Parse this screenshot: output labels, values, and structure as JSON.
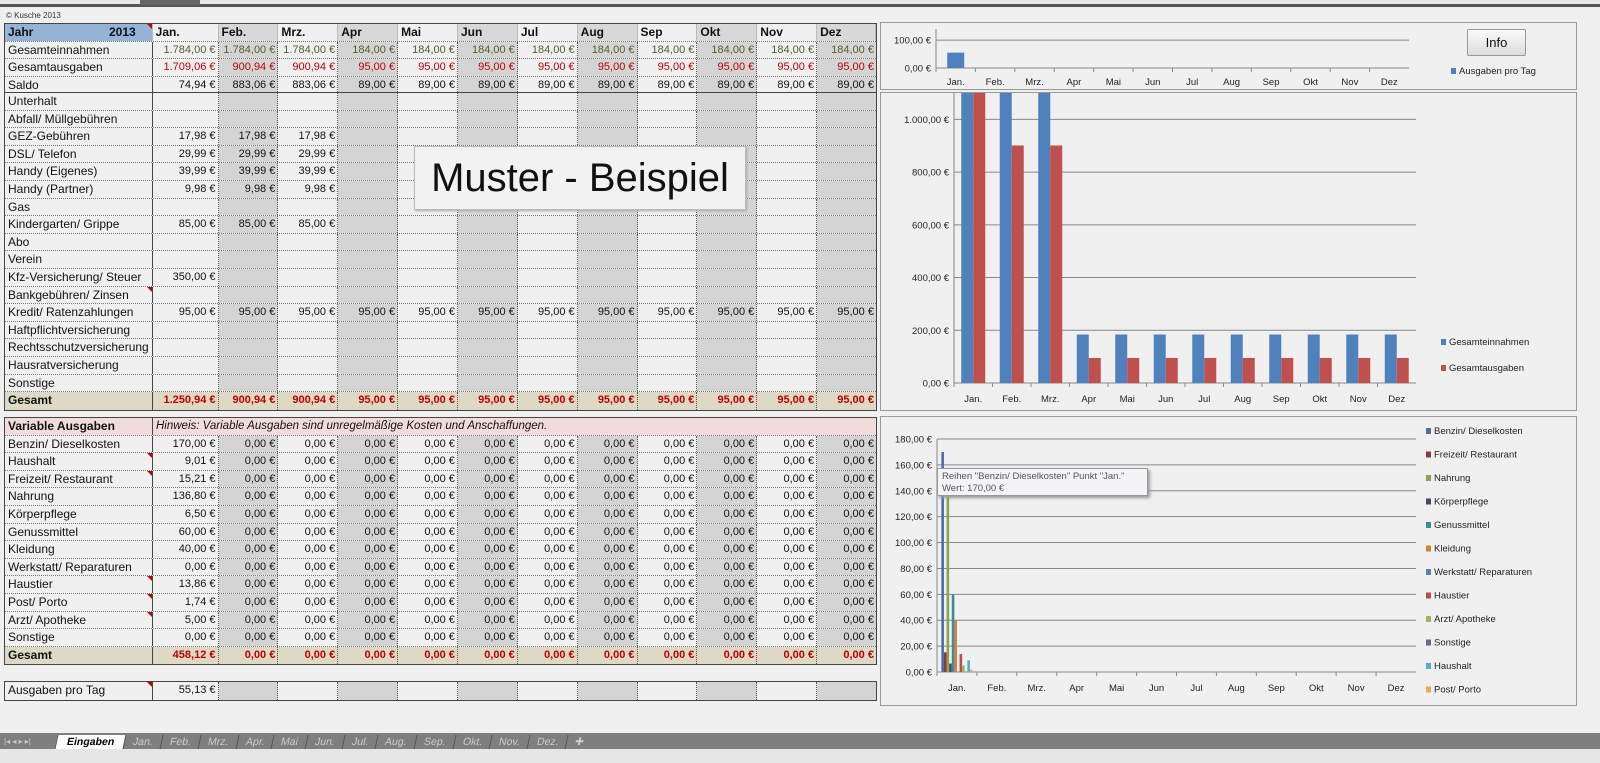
{
  "copyright": "© Kusche 2013",
  "header": {
    "jahr_label": "Jahr",
    "year": "2013"
  },
  "months": [
    "Jan.",
    "Feb.",
    "Mrz.",
    "Apr",
    "Mai",
    "Jun",
    "Jul",
    "Aug",
    "Sep",
    "Okt",
    "Nov",
    "Dez"
  ],
  "summary": [
    {
      "label": "Gesamteinnahmen",
      "color": "green",
      "values": [
        "1.784,00 €",
        "1.784,00 €",
        "1.784,00 €",
        "184,00 €",
        "184,00 €",
        "184,00 €",
        "184,00 €",
        "184,00 €",
        "184,00 €",
        "184,00 €",
        "184,00 €",
        "184,00 €"
      ]
    },
    {
      "label": "Gesamtausgaben",
      "color": "red",
      "values": [
        "1.709,06 €",
        "900,94 €",
        "900,94 €",
        "95,00 €",
        "95,00 €",
        "95,00 €",
        "95,00 €",
        "95,00 €",
        "95,00 €",
        "95,00 €",
        "95,00 €",
        "95,00 €"
      ]
    },
    {
      "label": "Saldo",
      "color": "",
      "values": [
        "74,94 €",
        "883,06 €",
        "883,06 €",
        "89,00 €",
        "89,00 €",
        "89,00 €",
        "89,00 €",
        "89,00 €",
        "89,00 €",
        "89,00 €",
        "89,00 €",
        "89,00 €"
      ]
    }
  ],
  "fixed": [
    {
      "label": "Unterhalt",
      "values": [
        "",
        "",
        "",
        "",
        "",
        "",
        "",
        "",
        "",
        "",
        "",
        ""
      ]
    },
    {
      "label": "Abfall/ Müllgebühren",
      "values": [
        "",
        "",
        "",
        "",
        "",
        "",
        "",
        "",
        "",
        "",
        "",
        ""
      ]
    },
    {
      "label": "GEZ-Gebühren",
      "values": [
        "17,98 €",
        "17,98 €",
        "17,98 €",
        "",
        "",
        "",
        "",
        "",
        "",
        "",
        "",
        ""
      ]
    },
    {
      "label": "DSL/ Telefon",
      "values": [
        "29,99 €",
        "29,99 €",
        "29,99 €",
        "",
        "",
        "",
        "",
        "",
        "",
        "",
        "",
        ""
      ]
    },
    {
      "label": "Handy (Eigenes)",
      "values": [
        "39,99 €",
        "39,99 €",
        "39,99 €",
        "",
        "",
        "",
        "",
        "",
        "",
        "",
        "",
        ""
      ]
    },
    {
      "label": "Handy (Partner)",
      "values": [
        "9,98 €",
        "9,98 €",
        "9,98 €",
        "",
        "",
        "",
        "",
        "",
        "",
        "",
        "",
        ""
      ]
    },
    {
      "label": "Gas",
      "values": [
        "",
        "",
        "",
        "",
        "",
        "",
        "",
        "",
        "",
        "",
        "",
        ""
      ]
    },
    {
      "label": "Kindergarten/ Grippe",
      "values": [
        "85,00 €",
        "85,00 €",
        "85,00 €",
        "",
        "",
        "",
        "",
        "",
        "",
        "",
        "",
        ""
      ]
    },
    {
      "label": "Abo",
      "values": [
        "",
        "",
        "",
        "",
        "",
        "",
        "",
        "",
        "",
        "",
        "",
        ""
      ]
    },
    {
      "label": "Verein",
      "values": [
        "",
        "",
        "",
        "",
        "",
        "",
        "",
        "",
        "",
        "",
        "",
        ""
      ]
    },
    {
      "label": "Kfz-Versicherung/ Steuer",
      "values": [
        "350,00 €",
        "",
        "",
        "",
        "",
        "",
        "",
        "",
        "",
        "",
        "",
        ""
      ]
    },
    {
      "label": "Bankgebühren/ Zinsen",
      "values": [
        "",
        "",
        "",
        "",
        "",
        "",
        "",
        "",
        "",
        "",
        "",
        ""
      ]
    },
    {
      "label": "Kredit/ Ratenzahlungen",
      "values": [
        "95,00 €",
        "95,00 €",
        "95,00 €",
        "95,00 €",
        "95,00 €",
        "95,00 €",
        "95,00 €",
        "95,00 €",
        "95,00 €",
        "95,00 €",
        "95,00 €",
        "95,00 €"
      ]
    },
    {
      "label": "Haftpflichtversicherung",
      "values": [
        "",
        "",
        "",
        "",
        "",
        "",
        "",
        "",
        "",
        "",
        "",
        ""
      ]
    },
    {
      "label": "Rechtsschutzversicherung",
      "values": [
        "",
        "",
        "",
        "",
        "",
        "",
        "",
        "",
        "",
        "",
        "",
        ""
      ]
    },
    {
      "label": "Hausratversicherung",
      "values": [
        "",
        "",
        "",
        "",
        "",
        "",
        "",
        "",
        "",
        "",
        "",
        ""
      ]
    },
    {
      "label": "Sonstige",
      "values": [
        "",
        "",
        "",
        "",
        "",
        "",
        "",
        "",
        "",
        "",
        "",
        ""
      ]
    }
  ],
  "fixed_total": {
    "label": "Gesamt",
    "values": [
      "1.250,94 €",
      "900,94 €",
      "900,94 €",
      "95,00 €",
      "95,00 €",
      "95,00 €",
      "95,00 €",
      "95,00 €",
      "95,00 €",
      "95,00 €",
      "95,00 €",
      "95,00 €"
    ]
  },
  "variable_header": {
    "label": "Variable Ausgaben",
    "hint": "Hinweis: Variable Ausgaben sind unregelmäßige Kosten und Anschaffungen."
  },
  "variable": [
    {
      "label": "Benzin/ Dieselkosten",
      "jan": "170,00 €"
    },
    {
      "label": "Haushalt",
      "jan": "9,01 €"
    },
    {
      "label": "Freizeit/ Restaurant",
      "jan": "15,21 €"
    },
    {
      "label": "Nahrung",
      "jan": "136,80 €"
    },
    {
      "label": "Körperpflege",
      "jan": "6,50 €"
    },
    {
      "label": "Genussmittel",
      "jan": "60,00 €"
    },
    {
      "label": "Kleidung",
      "jan": "40,00 €"
    },
    {
      "label": "Werkstatt/ Reparaturen",
      "jan": "0,00 €"
    },
    {
      "label": "Haustier",
      "jan": "13,86 €"
    },
    {
      "label": "Post/ Porto",
      "jan": "1,74 €"
    },
    {
      "label": "Arzt/ Apotheke",
      "jan": "5,00 €"
    },
    {
      "label": "Sonstige",
      "jan": "0,00 €"
    }
  ],
  "variable_zero": "0,00 €",
  "variable_total": {
    "label": "Gesamt",
    "values": [
      "458,12 €",
      "0,00 €",
      "0,00 €",
      "0,00 €",
      "0,00 €",
      "0,00 €",
      "0,00 €",
      "0,00 €",
      "0,00 €",
      "0,00 €",
      "0,00 €",
      "0,00 €"
    ]
  },
  "per_day": {
    "label": "Ausgaben pro Tag",
    "value": "55,13 €"
  },
  "overlay": "Muster - Beispiel",
  "info_button": "Info",
  "tooltip": {
    "line1": "Reihen \"Benzin/ Dieselkosten\" Punkt \"Jan.\"",
    "line2": "Wert: 170,00 €"
  },
  "sheet_tabs": [
    "Eingaben",
    "Jan.",
    "Feb.",
    "Mrz.",
    "Apr.",
    "Mai",
    "Jun.",
    "Jul.",
    "Aug.",
    "Sep.",
    "Okt.",
    "Nov.",
    "Dez."
  ],
  "chart_data": [
    {
      "type": "bar",
      "title": "",
      "categories": [
        "Jan.",
        "Feb.",
        "Mrz.",
        "Apr",
        "Mai",
        "Jun",
        "Jul",
        "Aug",
        "Sep",
        "Okt",
        "Nov",
        "Dez"
      ],
      "series": [
        {
          "name": "Ausgaben pro Tag",
          "color": "#4f81bd",
          "values": [
            55.13,
            0,
            0,
            0,
            0,
            0,
            0,
            0,
            0,
            0,
            0,
            0
          ]
        }
      ],
      "yticks": [
        "0,00 €",
        "100,00 €"
      ],
      "ylim": [
        0,
        140
      ],
      "legend": "right"
    },
    {
      "type": "bar",
      "categories": [
        "Jan.",
        "Feb.",
        "Mrz.",
        "Apr",
        "Mai",
        "Jun",
        "Jul",
        "Aug",
        "Sep",
        "Okt",
        "Nov",
        "Dez"
      ],
      "series": [
        {
          "name": "Gesamteinnahmen",
          "color": "#4f81bd",
          "values": [
            1784,
            1784,
            1784,
            184,
            184,
            184,
            184,
            184,
            184,
            184,
            184,
            184
          ]
        },
        {
          "name": "Gesamtausgaben",
          "color": "#c0504d",
          "values": [
            1709.06,
            900.94,
            900.94,
            95,
            95,
            95,
            95,
            95,
            95,
            95,
            95,
            95
          ]
        }
      ],
      "yticks": [
        "0,00 €",
        "200,00 €",
        "400,00 €",
        "600,00 €",
        "800,00 €",
        "1.000,00 €"
      ],
      "ylim": [
        0,
        1100
      ],
      "legend": "right"
    },
    {
      "type": "bar",
      "categories": [
        "Jan.",
        "Feb.",
        "Mrz.",
        "Apr",
        "Mai",
        "Jun",
        "Jul",
        "Aug",
        "Sep",
        "Okt",
        "Nov",
        "Dez"
      ],
      "series": [
        {
          "name": "Benzin/ Dieselkosten",
          "color": "#4a6fa5",
          "values": [
            170,
            0,
            0,
            0,
            0,
            0,
            0,
            0,
            0,
            0,
            0,
            0
          ]
        },
        {
          "name": "Freizeit/ Restaurant",
          "color": "#8c3a3a",
          "values": [
            15.21,
            0,
            0,
            0,
            0,
            0,
            0,
            0,
            0,
            0,
            0,
            0
          ]
        },
        {
          "name": "Nahrung",
          "color": "#8da24e",
          "values": [
            136.8,
            0,
            0,
            0,
            0,
            0,
            0,
            0,
            0,
            0,
            0,
            0
          ]
        },
        {
          "name": "Körperpflege",
          "color": "#4d4470",
          "values": [
            6.5,
            0,
            0,
            0,
            0,
            0,
            0,
            0,
            0,
            0,
            0,
            0
          ]
        },
        {
          "name": "Genussmittel",
          "color": "#3d8c9a",
          "values": [
            60,
            0,
            0,
            0,
            0,
            0,
            0,
            0,
            0,
            0,
            0,
            0
          ]
        },
        {
          "name": "Kleidung",
          "color": "#c98437",
          "values": [
            40,
            0,
            0,
            0,
            0,
            0,
            0,
            0,
            0,
            0,
            0,
            0
          ]
        },
        {
          "name": "Werkstatt/ Reparaturen",
          "color": "#5a82b8",
          "values": [
            0,
            0,
            0,
            0,
            0,
            0,
            0,
            0,
            0,
            0,
            0,
            0
          ]
        },
        {
          "name": "Haustier",
          "color": "#b54e4b",
          "values": [
            13.86,
            0,
            0,
            0,
            0,
            0,
            0,
            0,
            0,
            0,
            0,
            0
          ]
        },
        {
          "name": "Arzt/ Apotheke",
          "color": "#9bb560",
          "values": [
            5,
            0,
            0,
            0,
            0,
            0,
            0,
            0,
            0,
            0,
            0,
            0
          ]
        },
        {
          "name": "Sonstige",
          "color": "#6f61a0",
          "values": [
            0,
            0,
            0,
            0,
            0,
            0,
            0,
            0,
            0,
            0,
            0,
            0
          ]
        },
        {
          "name": "Haushalt",
          "color": "#4fb0c6",
          "values": [
            9.01,
            0,
            0,
            0,
            0,
            0,
            0,
            0,
            0,
            0,
            0,
            0
          ]
        },
        {
          "name": "Post/ Porto",
          "color": "#f0a55a",
          "values": [
            1.74,
            0,
            0,
            0,
            0,
            0,
            0,
            0,
            0,
            0,
            0,
            0
          ]
        }
      ],
      "yticks": [
        "0,00 €",
        "20,00 €",
        "40,00 €",
        "60,00 €",
        "80,00 €",
        "100,00 €",
        "120,00 €",
        "140,00 €",
        "160,00 €",
        "180,00 €"
      ],
      "ylim": [
        0,
        180
      ],
      "legend": "right"
    }
  ]
}
